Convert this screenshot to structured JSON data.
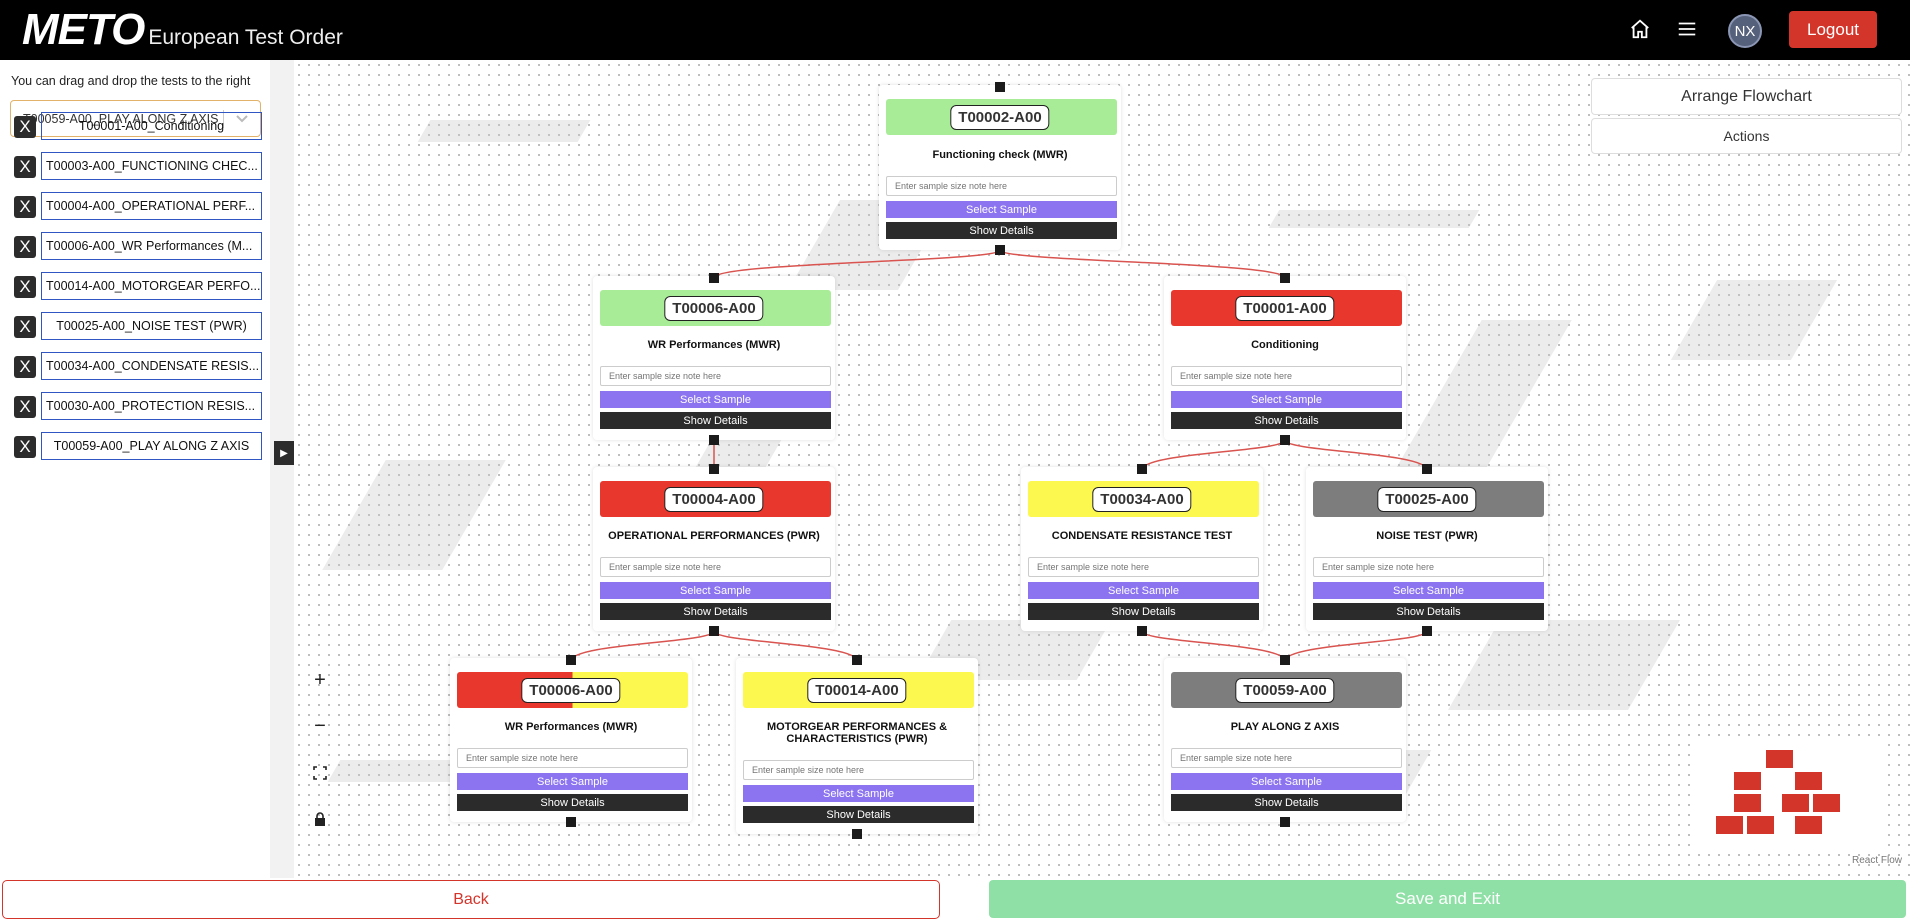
{
  "app": {
    "logo_mark": "METO",
    "logo_subtitle": "European Test Order"
  },
  "header": {
    "home_icon": "home-icon",
    "menu_icon": "hamburger-menu-icon",
    "avatar_initials": "NX",
    "logout_label": "Logout"
  },
  "sidebar": {
    "hint": "You can drag and drop the tests to the right",
    "select_value": "T00059-A00_PLAY ALONG Z AXIS",
    "remove_label": "X",
    "tests": [
      "T00001-A00_Conditioning",
      "T00003-A00_FUNCTIONING CHEC...",
      "T00004-A00_OPERATIONAL PERF...",
      "T00006-A00_WR Performances (M...",
      "T00014-A00_MOTORGEAR PERFO...",
      "T00025-A00_NOISE TEST (PWR)",
      "T00034-A00_CONDENSATE RESIS...",
      "T00030-A00_PROTECTION RESIS...",
      "T00059-A00_PLAY ALONG Z AXIS"
    ]
  },
  "flow": {
    "arrange_label": "Arrange Flowchart",
    "actions_label": "Actions",
    "note_placeholder": "Enter sample size note here",
    "select_sample_label": "Select Sample",
    "show_details_label": "Show Details",
    "nodes": [
      {
        "code": "T00002-A00",
        "title": "Functioning check (MWR)",
        "status_color": "#a8ec98"
      },
      {
        "code": "T00006-A00",
        "title": "WR Performances (MWR)",
        "status_color": "#a8ec98"
      },
      {
        "code": "T00001-A00",
        "title": "Conditioning",
        "status_color": "#e8372c"
      },
      {
        "code": "T00004-A00",
        "title": "OPERATIONAL PERFORMANCES (PWR)",
        "status_color": "#e8372c"
      },
      {
        "code": "T00034-A00",
        "title": "CONDENSATE RESISTANCE TEST",
        "status_color": "#fdf84f"
      },
      {
        "code": "T00025-A00",
        "title": "NOISE TEST (PWR)",
        "status_color": "#7d7d7d"
      },
      {
        "code": "T00006-A00",
        "title": "WR Performances (MWR)",
        "status_color": "#e8372c",
        "status_color_2": "#fdf84f"
      },
      {
        "code": "T00014-A00",
        "title": "MOTORGEAR PERFORMANCES & CHARACTERISTICS (PWR)",
        "status_color": "#fdf84f"
      },
      {
        "code": "T00059-A00",
        "title": "PLAY ALONG Z AXIS",
        "status_color": "#7d7d7d"
      }
    ],
    "controls": {
      "zoom_in": "+",
      "zoom_out": "−",
      "fit_icon": "fit-view-icon",
      "lock_icon": "lock-icon"
    },
    "edge_color": "#d9534f",
    "attribution": "React Flow"
  },
  "footer": {
    "back_label": "Back",
    "save_label": "Save and Exit"
  }
}
